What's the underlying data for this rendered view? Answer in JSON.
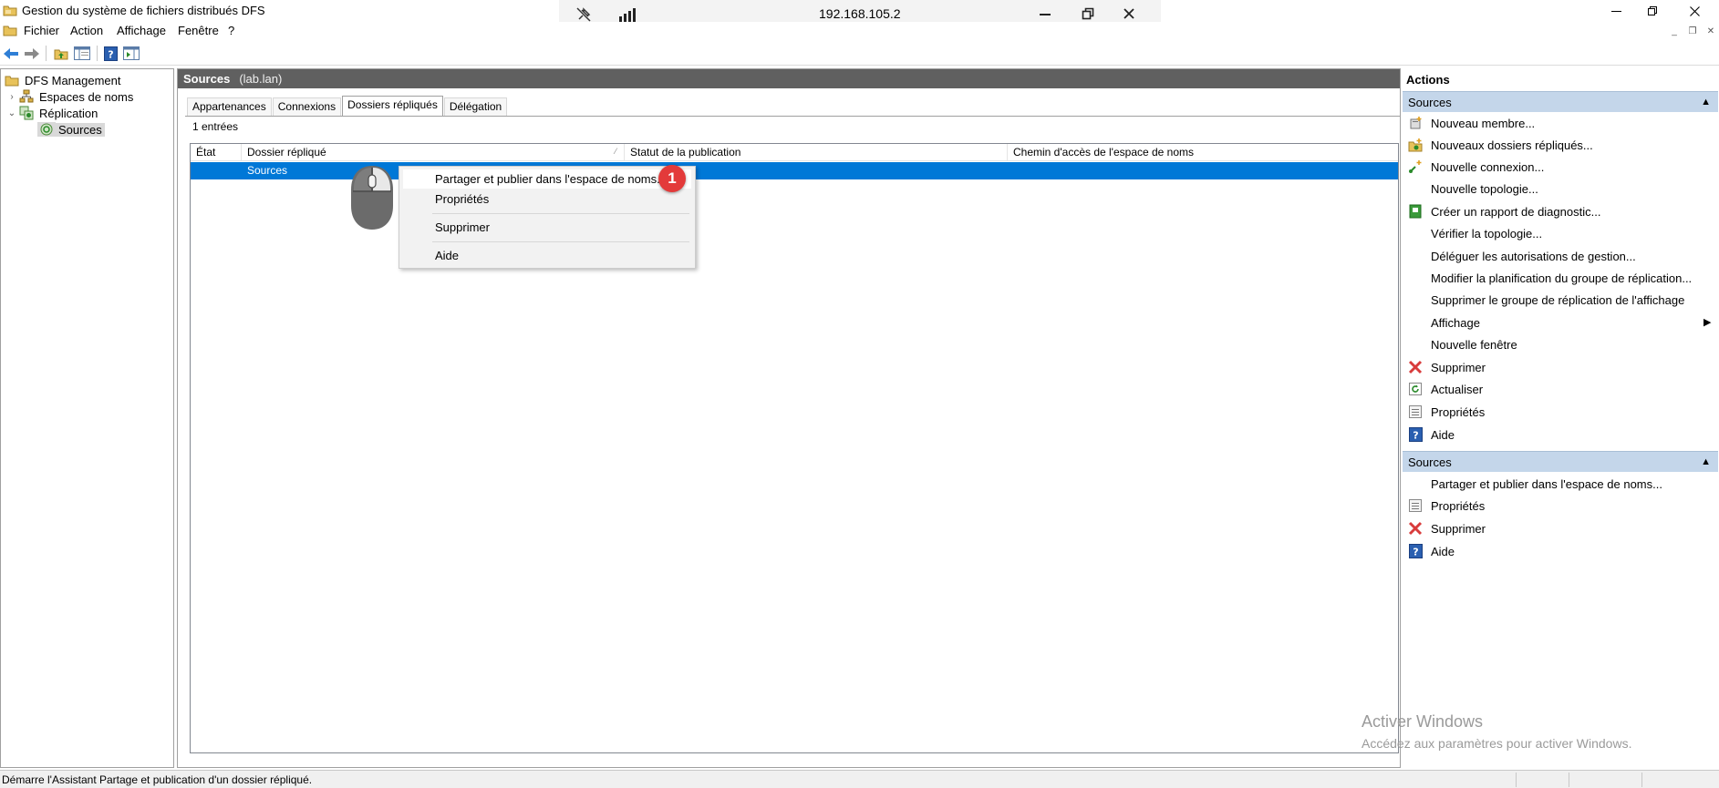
{
  "window": {
    "title": "Gestion du système de fichiers distribués DFS",
    "min_icon": "minimize-icon",
    "max_icon": "maximize-icon",
    "close_icon": "close-icon"
  },
  "rdp_bar": {
    "ip": "192.168.105.2",
    "pin_icon": "unpin-icon",
    "signal_icon": "signal-bars-icon"
  },
  "menubar": {
    "items": [
      "Fichier",
      "Action",
      "Affichage",
      "Fenêtre",
      "?"
    ]
  },
  "toolbar": {
    "buttons": [
      "back-arrow-icon",
      "forward-arrow-icon",
      "up-folder-icon",
      "show-hide-tree-icon",
      "help-icon",
      "show-hide-action-pane-icon"
    ]
  },
  "tree": {
    "items": [
      {
        "label": "DFS Management",
        "icon": "dfs-management-icon",
        "level": 0
      },
      {
        "label": "Espaces de noms",
        "icon": "namespaces-icon",
        "level": 1,
        "expander": "›"
      },
      {
        "label": "Réplication",
        "icon": "replication-icon",
        "level": 1,
        "expander": "⌄"
      },
      {
        "label": "Sources",
        "icon": "replication-group-icon",
        "level": 2,
        "selected": true
      }
    ]
  },
  "center": {
    "header_title": "Sources",
    "header_sub": "(lab.lan)",
    "tabs": [
      "Appartenances",
      "Connexions",
      "Dossiers répliqués",
      "Délégation"
    ],
    "active_tab": "Dossiers répliqués",
    "entries_count": "1 entrées",
    "columns": [
      "État",
      "Dossier répliqué",
      "Statut de la publication",
      "Chemin d'accès de l'espace de noms"
    ],
    "rows": [
      {
        "etat": "",
        "dossier": "Sources",
        "statut": "",
        "chemin": ""
      }
    ]
  },
  "context_menu": {
    "items": [
      {
        "label": "Partager et publier dans l'espace de noms...",
        "hover": true
      },
      {
        "label": "Propriétés"
      },
      {
        "label": "Supprimer"
      },
      {
        "label": "Aide"
      }
    ]
  },
  "step_badge": "1",
  "actions": {
    "title": "Actions",
    "sections": [
      {
        "title": "Sources",
        "items": [
          {
            "label": "Nouveau membre...",
            "icon": "new-member-icon"
          },
          {
            "label": "Nouveaux dossiers répliqués...",
            "icon": "new-replicated-folders-icon"
          },
          {
            "label": "Nouvelle connexion...",
            "icon": "new-connection-icon"
          },
          {
            "label": "Nouvelle topologie...",
            "icon": ""
          },
          {
            "label": "Créer un rapport de diagnostic...",
            "icon": "diagnostic-report-icon"
          },
          {
            "label": "Vérifier la topologie...",
            "icon": ""
          },
          {
            "label": "Déléguer les autorisations de gestion...",
            "icon": ""
          },
          {
            "label": "Modifier la planification du groupe de réplication...",
            "icon": ""
          },
          {
            "label": "Supprimer le groupe de réplication de l'affichage",
            "icon": ""
          },
          {
            "label": "Affichage",
            "icon": "",
            "submenu": true
          },
          {
            "label": "Nouvelle fenêtre",
            "icon": ""
          },
          {
            "label": "Supprimer",
            "icon": "delete-icon"
          },
          {
            "label": "Actualiser",
            "icon": "refresh-icon"
          },
          {
            "label": "Propriétés",
            "icon": "properties-icon"
          },
          {
            "label": "Aide",
            "icon": "help-icon"
          }
        ]
      },
      {
        "title": "Sources",
        "items": [
          {
            "label": "Partager et publier dans l'espace de noms...",
            "icon": ""
          },
          {
            "label": "Propriétés",
            "icon": "properties-icon"
          },
          {
            "label": "Supprimer",
            "icon": "delete-icon"
          },
          {
            "label": "Aide",
            "icon": "help-icon"
          }
        ]
      }
    ]
  },
  "watermark": {
    "title": "Activer Windows",
    "subtitle": "Accédez aux paramètres pour activer Windows."
  },
  "statusbar": {
    "text": "Démarre l'Assistant Partage et publication d'un dossier répliqué."
  },
  "colors": {
    "selection": "#0078d7",
    "header_bar": "#606060",
    "actions_section": "#c4d6ea",
    "step_badge": "#e33a3a",
    "delete_red": "#d83b3b",
    "help_blue": "#2a5fb0"
  }
}
